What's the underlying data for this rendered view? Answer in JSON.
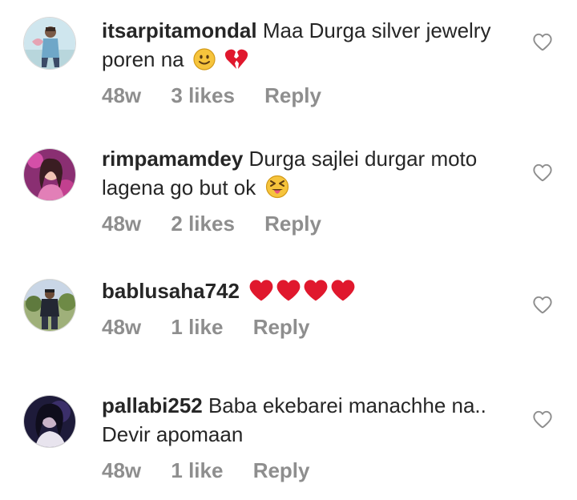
{
  "comments": [
    {
      "username": "itsarpitamondal",
      "text": "Maa Durga silver jewelry poren na",
      "emojis": [
        "slightly-smiling-face-emoji",
        "broken-heart-emoji"
      ],
      "age": "48w",
      "likes": "3 likes",
      "reply": "Reply"
    },
    {
      "username": "rimpamamdey",
      "text": "Durga sajlei durgar moto lagena go but ok",
      "emojis": [
        "squinting-face-with-tongue-emoji"
      ],
      "age": "48w",
      "likes": "2 likes",
      "reply": "Reply"
    },
    {
      "username": "bablusaha742",
      "text": "",
      "emojis": [
        "red-heart-emoji",
        "red-heart-emoji",
        "red-heart-emoji",
        "red-heart-emoji"
      ],
      "age": "48w",
      "likes": "1 like",
      "reply": "Reply"
    },
    {
      "username": "pallabi252",
      "text": "Baba ekebarei manachhe na.. Devir apomaan",
      "emojis": [],
      "age": "48w",
      "likes": "1 like",
      "reply": "Reply"
    }
  ],
  "icons": {
    "like": "heart-outline-icon"
  },
  "colors": {
    "text": "#262626",
    "meta": "#8e8e8e",
    "heart": "#e0182d",
    "icon": "#8e8e8e"
  }
}
